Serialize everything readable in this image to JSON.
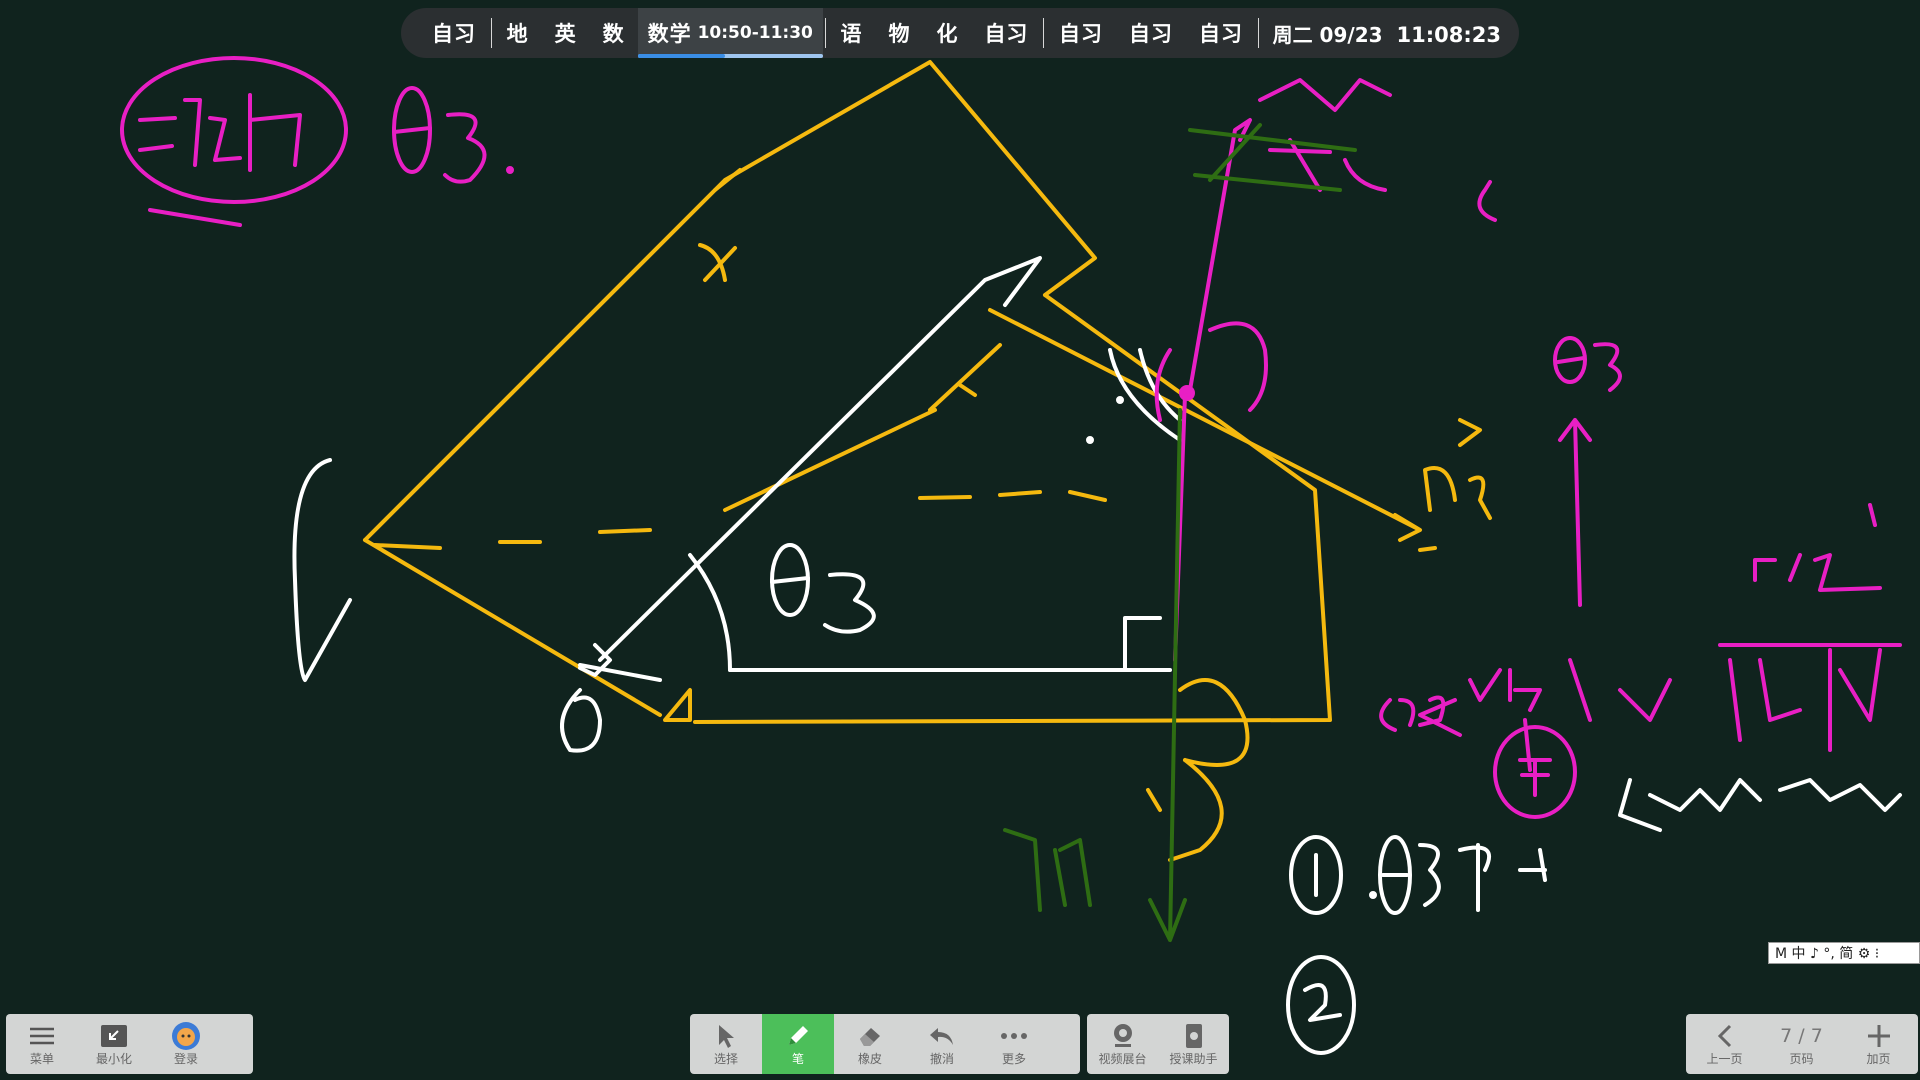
{
  "schedule": {
    "slots": [
      "自习",
      "地",
      "英",
      "数",
      "数学",
      "语",
      "物",
      "化",
      "自习",
      "自习",
      "自习",
      "自习"
    ],
    "current_time": "10:50-11:30",
    "current_progress": 0.47,
    "day_date": "周二 09/23",
    "clock": "11:08:23"
  },
  "toolbar_left": {
    "menu": "菜单",
    "minimize": "最小化",
    "login": "登录"
  },
  "toolbar_center": {
    "select": "选择",
    "pen": "笔",
    "eraser": "橡皮",
    "undo": "撤消",
    "more": "更多"
  },
  "toolbar_media": {
    "video": "视频展台",
    "assistant": "授课助手"
  },
  "toolbar_right": {
    "prev": "上一页",
    "page_value": "7 / 7",
    "page_label": "页码",
    "add": "加页"
  },
  "ime_bar": {
    "text": "M 中 ♪ °, 简 ⚙ ⁝"
  },
  "ink_colors": {
    "yellow": "#f5b90f",
    "white": "#ffffff",
    "magenta": "#e81fc4",
    "green": "#2e6d13"
  }
}
